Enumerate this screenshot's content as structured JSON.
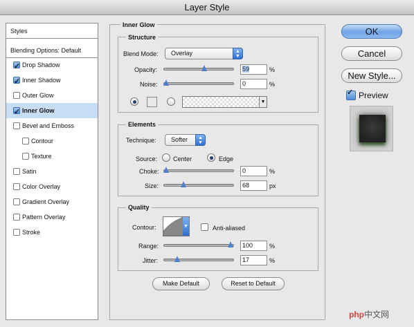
{
  "window": {
    "title": "Layer Style"
  },
  "sidebar": {
    "styles_label": "Styles",
    "blending_label": "Blending Options: Default",
    "items": [
      {
        "label": "Drop Shadow",
        "checked": true
      },
      {
        "label": "Inner Shadow",
        "checked": true
      },
      {
        "label": "Outer Glow",
        "checked": false
      },
      {
        "label": "Inner Glow",
        "checked": true,
        "selected": true
      },
      {
        "label": "Bevel and Emboss",
        "checked": false
      },
      {
        "label": "Contour",
        "checked": false,
        "indent": true
      },
      {
        "label": "Texture",
        "checked": false,
        "indent": true
      },
      {
        "label": "Satin",
        "checked": false
      },
      {
        "label": "Color Overlay",
        "checked": false
      },
      {
        "label": "Gradient Overlay",
        "checked": false
      },
      {
        "label": "Pattern Overlay",
        "checked": false
      },
      {
        "label": "Stroke",
        "checked": false
      }
    ]
  },
  "panel": {
    "title": "Inner Glow",
    "structure": {
      "legend": "Structure",
      "blend_mode_label": "Blend Mode:",
      "blend_mode_value": "Overlay",
      "opacity_label": "Opacity:",
      "opacity_value": "59",
      "opacity_fraction": 0.59,
      "noise_label": "Noise:",
      "noise_value": "0",
      "noise_fraction": 0,
      "pct": "%"
    },
    "elements": {
      "legend": "Elements",
      "technique_label": "Technique:",
      "technique_value": "Softer",
      "source_label": "Source:",
      "source_center": "Center",
      "source_edge": "Edge",
      "source_selected": "Edge",
      "choke_label": "Choke:",
      "choke_value": "0",
      "choke_fraction": 0,
      "size_label": "Size:",
      "size_value": "68",
      "size_unit": "px",
      "size_fraction": 0.27,
      "pct": "%"
    },
    "quality": {
      "legend": "Quality",
      "contour_label": "Contour:",
      "anti_aliased_label": "Anti-aliased",
      "anti_aliased": false,
      "range_label": "Range:",
      "range_value": "100",
      "range_fraction": 1.0,
      "jitter_label": "Jitter:",
      "jitter_value": "17",
      "jitter_fraction": 0.17,
      "pct": "%"
    },
    "make_default": "Make Default",
    "reset_default": "Reset to Default"
  },
  "actions": {
    "ok": "OK",
    "cancel": "Cancel",
    "new_style": "New Style...",
    "preview_label": "Preview",
    "preview_checked": true
  },
  "watermark": {
    "brand": "php",
    "suffix": "中文网"
  },
  "colors": {
    "accent": "#4f7fcf",
    "selected_row": "#c9dcf5",
    "background": "#e8e8e8"
  }
}
